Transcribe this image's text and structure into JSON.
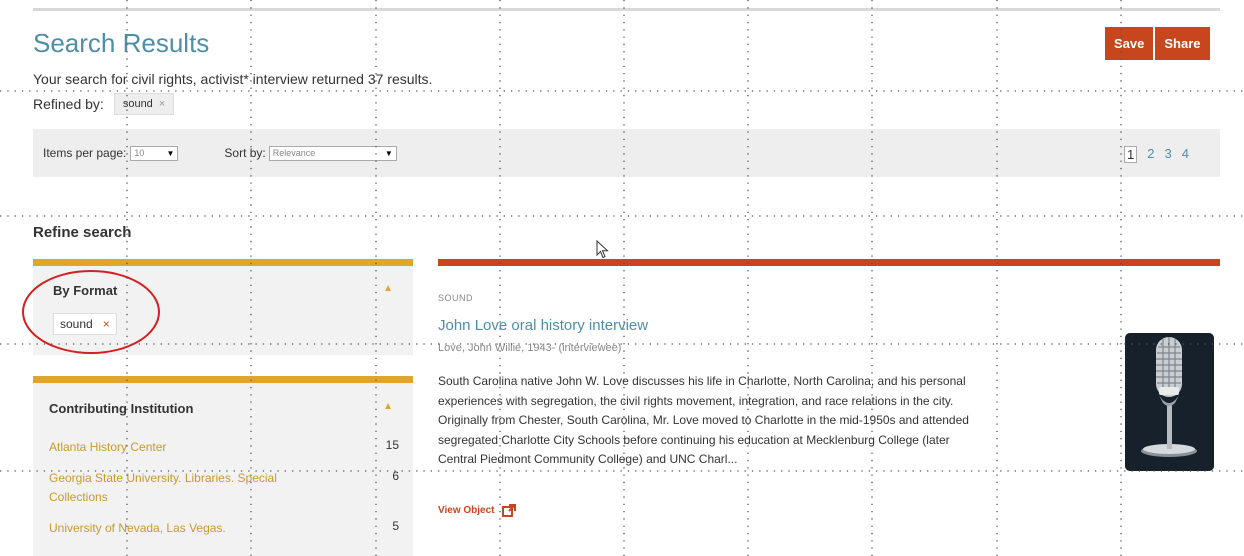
{
  "header": {
    "title": "Search Results",
    "save_label": "Save",
    "share_label": "Share"
  },
  "summary": {
    "text": "Your search for civil rights, activist* interview returned 37 results.",
    "refined_label": "Refined by:",
    "refined_chip": "sound",
    "chip_remove": "×"
  },
  "toolbar": {
    "items_label": "Items per page:",
    "items_value": "10",
    "sort_label": "Sort by:",
    "sort_value": "Relevance",
    "pages": [
      "1",
      "2",
      "3",
      "4"
    ],
    "current_page": "1"
  },
  "refine": {
    "title": "Refine search",
    "format": {
      "heading": "By Format",
      "chip": "sound",
      "chip_remove": "×"
    },
    "institution": {
      "heading": "Contributing Institution",
      "items": [
        {
          "name": "Atlanta History Center",
          "count": "15"
        },
        {
          "name": "Georgia State University. Libraries. Special Collections",
          "count": "6"
        },
        {
          "name": "University of Nevada, Las Vegas.",
          "count": "5"
        }
      ]
    }
  },
  "result": {
    "type": "SOUND",
    "title": "John Love oral history interview",
    "creator": "Love, John Willie, 1943- (interviewee)",
    "description": "South Carolina native John W. Love discusses his life in Charlotte, North Carolina, and his personal experiences with segregation, the civil rights movement, integration, and race relations in the city. Originally from Chester, South Carolina, Mr. Love moved to Charlotte in the mid-1950s and attended segregated Charlotte City Schools before continuing his education at Mecklenburg College (later Central Piedmont Community College) and UNC Charl...",
    "view_label": "View Object",
    "thumbnail_icon": "microphone-icon"
  },
  "colors": {
    "accent_orange": "#c8461d",
    "facet_gold": "#e2a42b",
    "link_blue": "#4e8ea8",
    "institution_gold": "#c89a2a",
    "annotation_red": "#d42020"
  }
}
